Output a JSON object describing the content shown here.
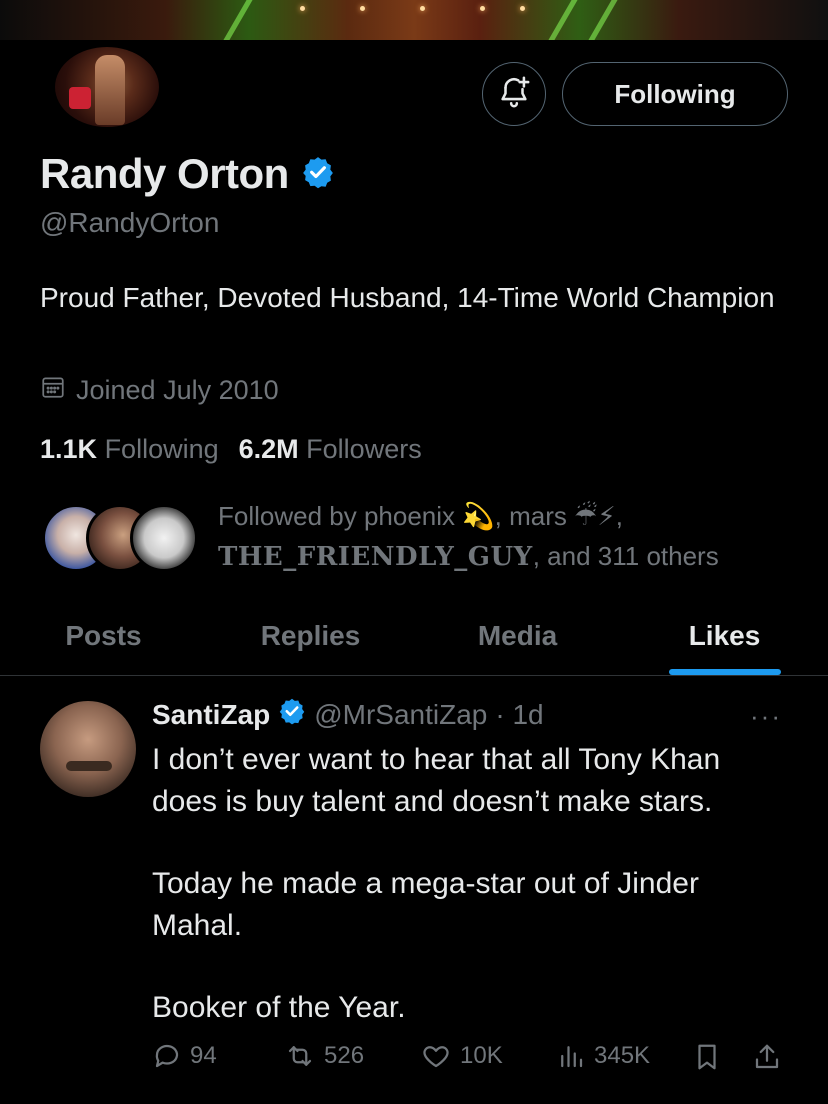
{
  "profile": {
    "name": "Randy Orton",
    "handle": "@RandyOrton",
    "bio": "Proud Father, Devoted Husband, 14-Time World Champion",
    "joined": "Joined July 2010",
    "following_count": "1.1K",
    "following_label": "Following",
    "followers_count": "6.2M",
    "followers_label": "Followers",
    "follow_button": "Following"
  },
  "followed_by": {
    "prefix": "Followed by phoenix",
    "emoji1": "💫",
    "mid": ", mars",
    "emoji2": "☔⚡",
    "sep": ",",
    "name3": "THE_FRIENDLY_GUY",
    "suffix": ", and 311 others"
  },
  "tabs": [
    {
      "label": "Posts"
    },
    {
      "label": "Replies"
    },
    {
      "label": "Media"
    },
    {
      "label": "Likes"
    }
  ],
  "active_tab": "Likes",
  "tweet": {
    "author_name": "SantiZap",
    "author_handle": "@MrSantiZap",
    "time": "· 1d",
    "more": "···",
    "paragraphs": [
      "I don’t ever want to hear that all Tony Khan does is buy talent and doesn’t make stars.",
      "Today he made a mega-star out of Jinder Mahal.",
      "Booker of the Year."
    ],
    "replies": "94",
    "reposts": "526",
    "likes": "10K",
    "views": "345K"
  },
  "colors": {
    "accent": "#1d9bf0",
    "muted": "#71767b",
    "text": "#e7e9ea",
    "background": "#000000",
    "border": "#2f3336"
  },
  "icons": [
    "bell-plus-icon",
    "verified-badge-icon",
    "calendar-icon",
    "reply-icon",
    "repost-icon",
    "like-icon",
    "views-icon",
    "bookmark-icon",
    "share-icon",
    "more-icon"
  ]
}
